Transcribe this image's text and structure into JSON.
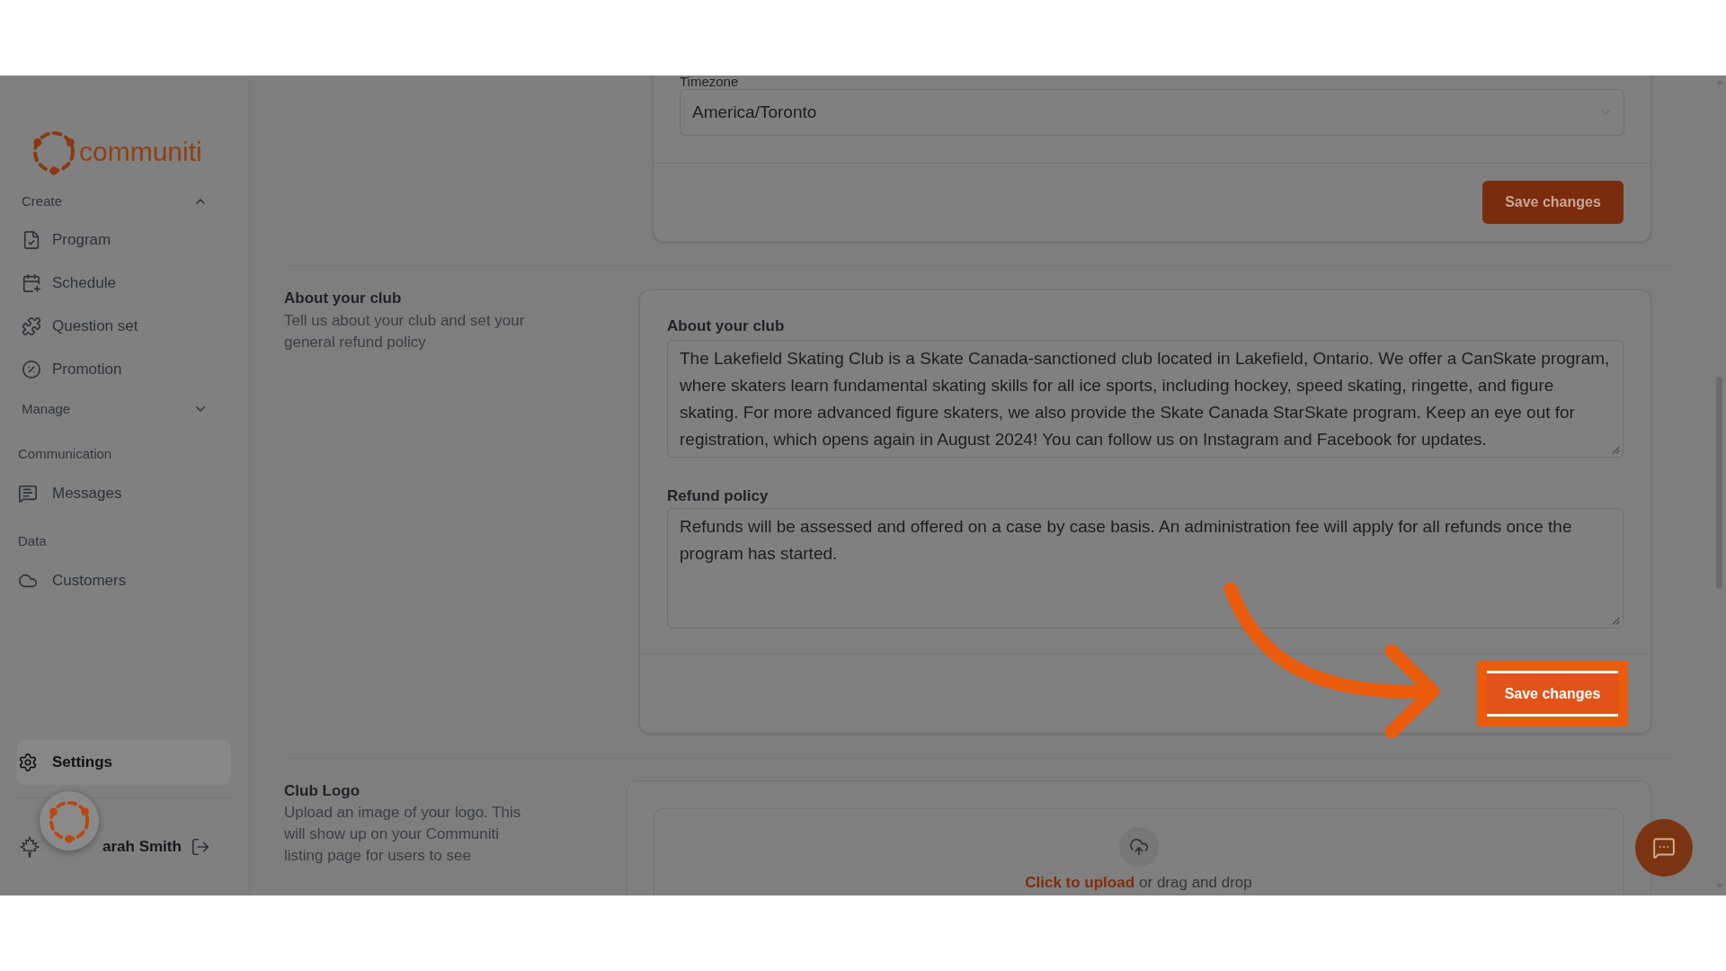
{
  "sidebar": {
    "logo_text": "communiti",
    "groups": [
      {
        "kind": "collapsible",
        "label": "Create",
        "expanded": true,
        "items": [
          {
            "label": "Program",
            "selected": false
          },
          {
            "label": "Schedule",
            "selected": false
          },
          {
            "label": "Question set",
            "selected": false
          },
          {
            "label": "Promotion",
            "selected": false
          }
        ]
      },
      {
        "kind": "collapsible",
        "label": "Manage",
        "expanded": false
      },
      {
        "kind": "heading",
        "label": "Communication",
        "items": [
          {
            "label": "Messages",
            "selected": false
          }
        ]
      },
      {
        "kind": "heading",
        "label": "Data",
        "items": [
          {
            "label": "Customers",
            "selected": false
          }
        ]
      }
    ],
    "settings": {
      "label": "Settings",
      "selected": true
    },
    "user": {
      "name": "arah Smith"
    }
  },
  "main": {
    "timezone": {
      "label": "Timezone",
      "value": "America/Toronto",
      "save_button": {
        "label": "Save changes",
        "highlighted": false
      }
    },
    "about": {
      "title": "About your club",
      "description": "Tell us about your club and set your general refund policy",
      "fields": [
        {
          "label": "About your club",
          "value": "The Lakefield Skating Club is a Skate Canada-sanctioned club located in Lakefield, Ontario. We offer a CanSkate program, where skaters learn fundamental skating skills for all ice sports, including hockey, speed skating, ringette, and figure skating. For more advanced figure skaters, we also provide the Skate Canada StarSkate program. Keep an eye out for registration, which opens again in August 2024! You can follow us on Instagram and Facebook for updates."
        },
        {
          "label": "Refund policy",
          "value": "Refunds will be assessed and offered on a case by case basis. An administration fee will apply for all refunds once the program has started."
        }
      ],
      "save_button": {
        "label": "Save changes",
        "highlighted": true
      }
    },
    "club_logo": {
      "title": "Club Logo",
      "description": "Upload an image of your logo. This will show up on your Communiti listing page for users to see",
      "upload_link": "Click to upload",
      "upload_hint": "or drag and drop"
    }
  }
}
